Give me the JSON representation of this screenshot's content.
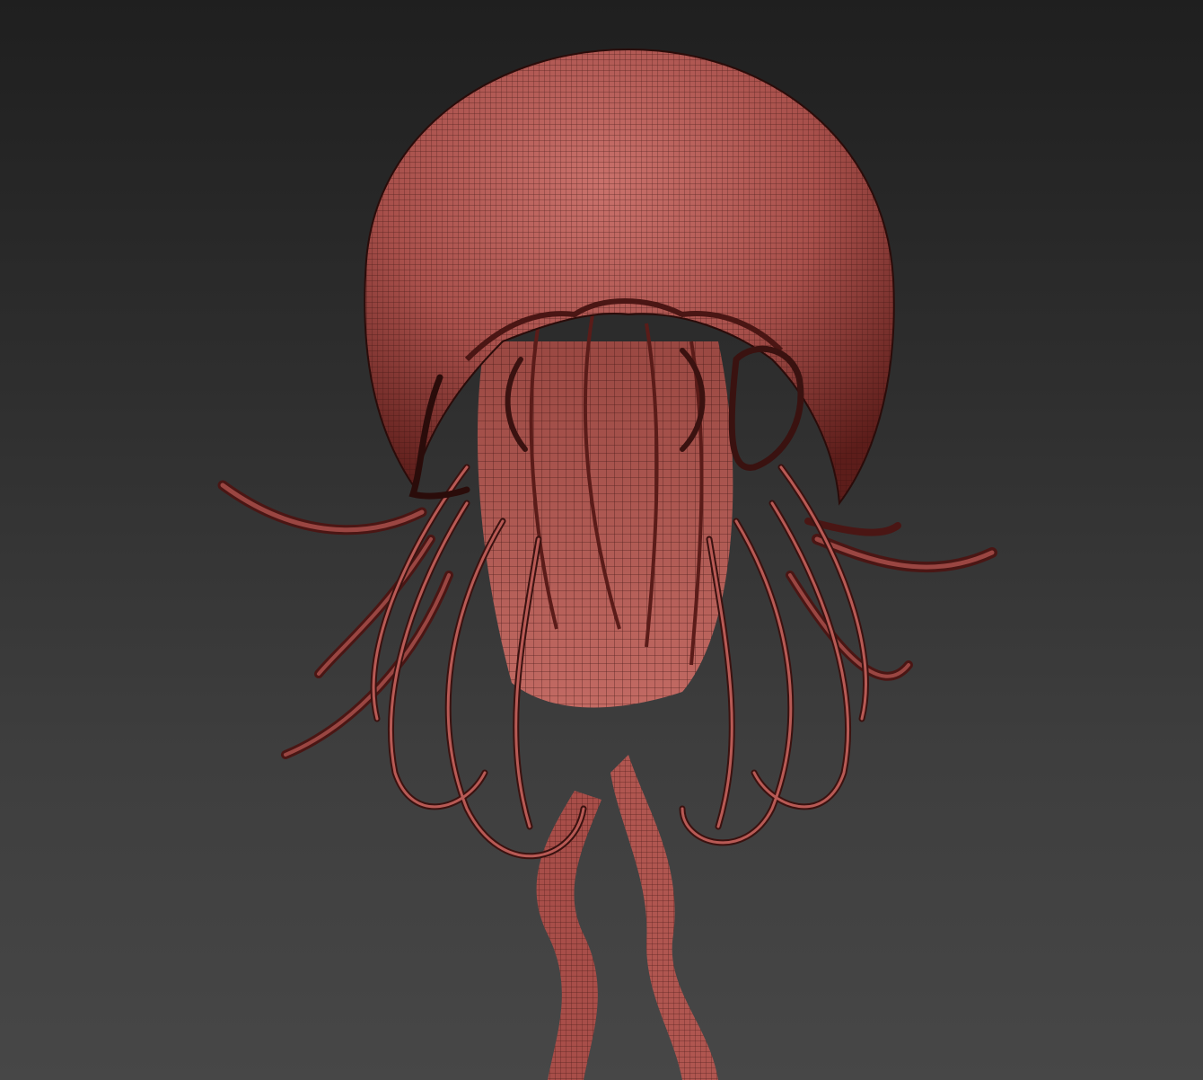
{
  "viewport": {
    "background_top": "#1f1f1f",
    "background_bottom": "#474747"
  },
  "model": {
    "subject": "jellyfish",
    "display_mode": "polyframe-wireframe",
    "surface_color": "#b85a55",
    "wire_color": "#3a1210",
    "shadow_color": "#4a1614",
    "highlight_color": "#d4807a"
  }
}
